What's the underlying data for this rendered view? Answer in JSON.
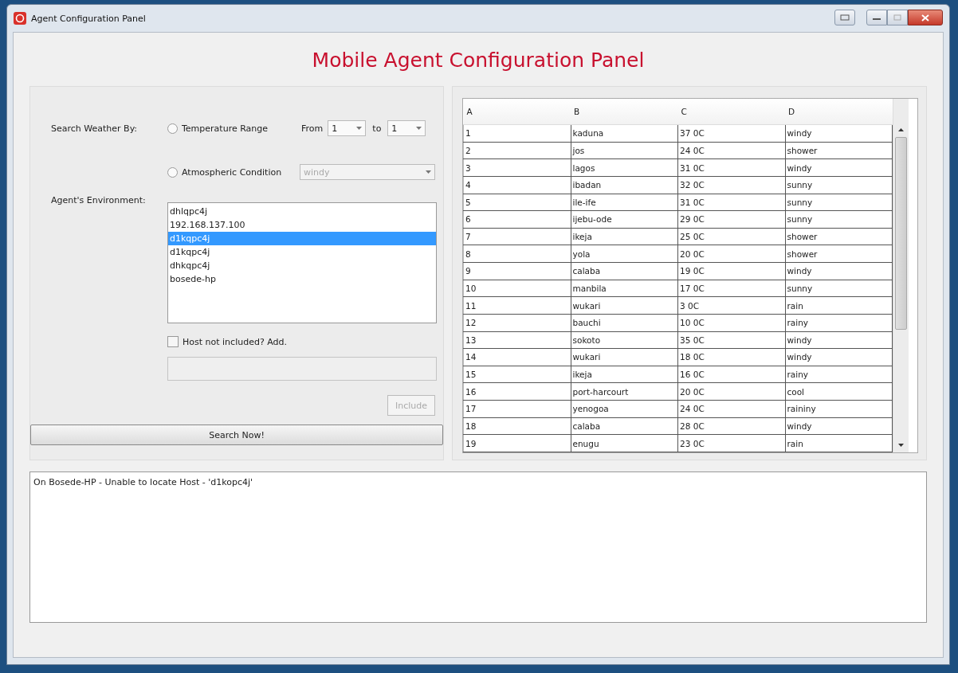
{
  "window": {
    "title": "Agent Configuration Panel"
  },
  "heading": "Mobile Agent Configuration Panel",
  "search": {
    "label": "Search Weather By:",
    "options": [
      {
        "kind": "range",
        "label": "Temperature Range",
        "selected": false
      },
      {
        "kind": "condition",
        "label": "Atmospheric Condition",
        "selected": false
      }
    ],
    "from_label": "From",
    "from_value": "1",
    "to_label": "to",
    "to_value": "1",
    "condition": {
      "value": "windy",
      "disabled": true
    }
  },
  "environment": {
    "label": "Agent's Environment:",
    "hosts": [
      {
        "name": "dhlqpc4j",
        "selected": false
      },
      {
        "name": "192.168.137.100",
        "selected": false
      },
      {
        "name": "d1kqpc4j",
        "selected": true
      },
      {
        "name": "d1kqpc4j",
        "selected": false
      },
      {
        "name": "dhkqpc4j",
        "selected": false
      },
      {
        "name": "bosede-hp",
        "selected": false
      }
    ]
  },
  "add_host": {
    "label": "Host not included? Add.",
    "checked": false,
    "field_disabled": true
  },
  "include_button": {
    "label": "Include",
    "disabled": true
  },
  "search_button": "Search Now!",
  "table": {
    "columns": [
      "A",
      "B",
      "C",
      "D"
    ],
    "rows": [
      [
        "1",
        "kaduna",
        "37 0C",
        "windy"
      ],
      [
        "2",
        "jos",
        "24 0C",
        "shower"
      ],
      [
        "3",
        "lagos",
        "31 0C",
        "windy"
      ],
      [
        "4",
        "ibadan",
        "32 0C",
        "sunny"
      ],
      [
        "5",
        "ile-ife",
        "31 0C",
        "sunny"
      ],
      [
        "6",
        "ijebu-ode",
        "29 0C",
        "sunny"
      ],
      [
        "7",
        "ikeja",
        "25 0C",
        "shower"
      ],
      [
        "8",
        "yola",
        "20 0C",
        "shower"
      ],
      [
        "9",
        "calaba",
        "19 0C",
        "windy"
      ],
      [
        "10",
        "manbila",
        "17 0C",
        "sunny"
      ],
      [
        "11",
        "wukari",
        "3 0C",
        "rain"
      ],
      [
        "12",
        "bauchi",
        "10 0C",
        "rainy"
      ],
      [
        "13",
        "sokoto",
        "35 0C",
        "windy"
      ],
      [
        "14",
        "wukari",
        "18 0C",
        "windy"
      ],
      [
        "15",
        "ikeja",
        "16 0C",
        "rainy"
      ],
      [
        "16",
        "port-harcourt",
        "20 0C",
        "cool"
      ],
      [
        "17",
        "yenogoa",
        "24 0C",
        "raininy"
      ],
      [
        "18",
        "calaba",
        "28 0C",
        "windy"
      ],
      [
        "19",
        "enugu",
        "23 0C",
        "rain"
      ]
    ]
  },
  "log": "On Bosede-HP - Unable to locate Host - 'd1kopc4j'"
}
